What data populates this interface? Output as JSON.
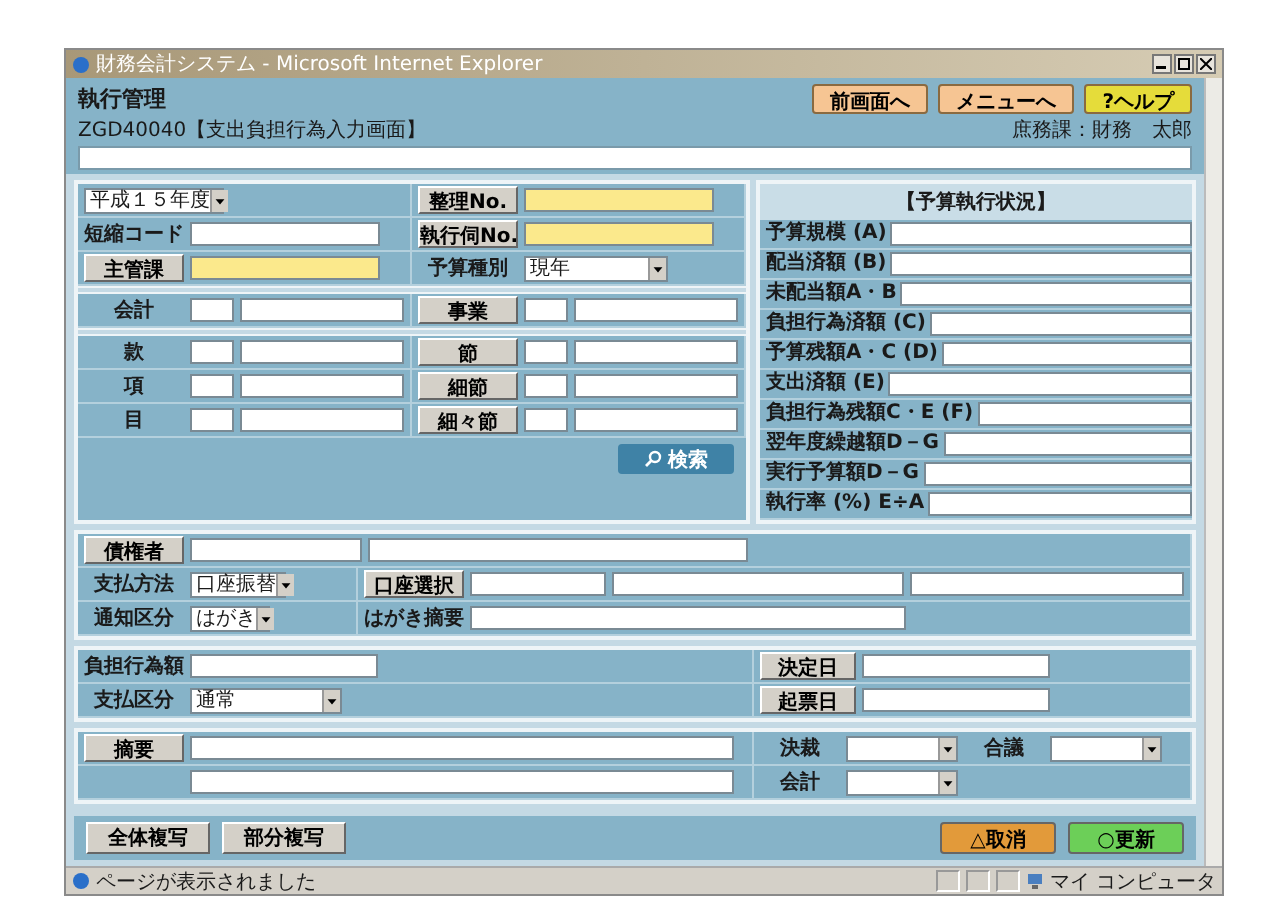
{
  "window": {
    "title": "財務会計システム - Microsoft Internet Explorer"
  },
  "header": {
    "title": "執行管理",
    "screen_id": "ZGD40040【支出負担行為入力画面】",
    "user": "庶務課：財務　太郎",
    "buttons": [
      {
        "label": "前画面へ",
        "kind": "nav"
      },
      {
        "label": "メニューへ",
        "kind": "nav"
      },
      {
        "label": "?ヘルプ",
        "kind": "help"
      }
    ]
  },
  "keys": [
    {
      "left": {
        "kind": "bare",
        "value": "平成１５年度"
      },
      "right": {
        "kind": "button",
        "label": "整理No.",
        "required": true
      }
    },
    {
      "left": {
        "kind": "label",
        "label": "短縮コード",
        "required": false
      },
      "right": {
        "kind": "button",
        "label": "執行伺No.",
        "required": true
      }
    },
    {
      "left": {
        "kind": "button",
        "label": "主管課",
        "required": true
      },
      "right": {
        "kind": "label",
        "label": "予算種別",
        "value": "現年"
      }
    }
  ],
  "budget_codes": [
    {
      "left": {
        "kind": "label",
        "label": "会計"
      },
      "right": {
        "kind": "button",
        "label": "事業"
      }
    }
  ],
  "budget_items": [
    {
      "left": {
        "kind": "label",
        "label": "款"
      },
      "right": {
        "kind": "button",
        "label": "節"
      }
    },
    {
      "left": {
        "kind": "label",
        "label": "項"
      },
      "right": {
        "kind": "button",
        "label": "細節"
      }
    },
    {
      "left": {
        "kind": "label",
        "label": "目"
      },
      "right": {
        "kind": "button",
        "label": "細々節"
      }
    }
  ],
  "search_button": "検索",
  "status_panel": {
    "title": "【予算執行状況】",
    "rows": [
      "予算規模 (A)",
      "配当済額 (B)",
      "未配当額A・B",
      "負担行為済額 (C)",
      "予算残額A・C (D)",
      "支出済額 (E)",
      "負担行為残額C・E (F)",
      "翌年度繰越額D－G",
      "実行予算額D－G",
      "執行率 (%) E÷A"
    ]
  },
  "payment": {
    "creditor": "債権者",
    "method": {
      "label": "支払方法",
      "value": "口座振替"
    },
    "account_select": "口座選択",
    "notice": {
      "label": "通知区分",
      "value": "はがき"
    },
    "postcard_note": "はがき摘要"
  },
  "amounts": {
    "amount": "負担行為額",
    "decision_date": "決定日",
    "payment_type": {
      "label": "支払区分",
      "value": "通常"
    },
    "draft_date": "起票日"
  },
  "remarks": {
    "label": "摘要",
    "approvals": [
      "決裁",
      "合議",
      "会計"
    ]
  },
  "footer": {
    "copy_buttons": [
      "全体複写",
      "部分複写"
    ],
    "actions": [
      {
        "label": "△取消",
        "kind": "cancel"
      },
      {
        "label": "○更新",
        "kind": "update"
      }
    ]
  },
  "status_bar": {
    "message": "ページが表示されました",
    "zone": "マイ コンピュータ"
  }
}
